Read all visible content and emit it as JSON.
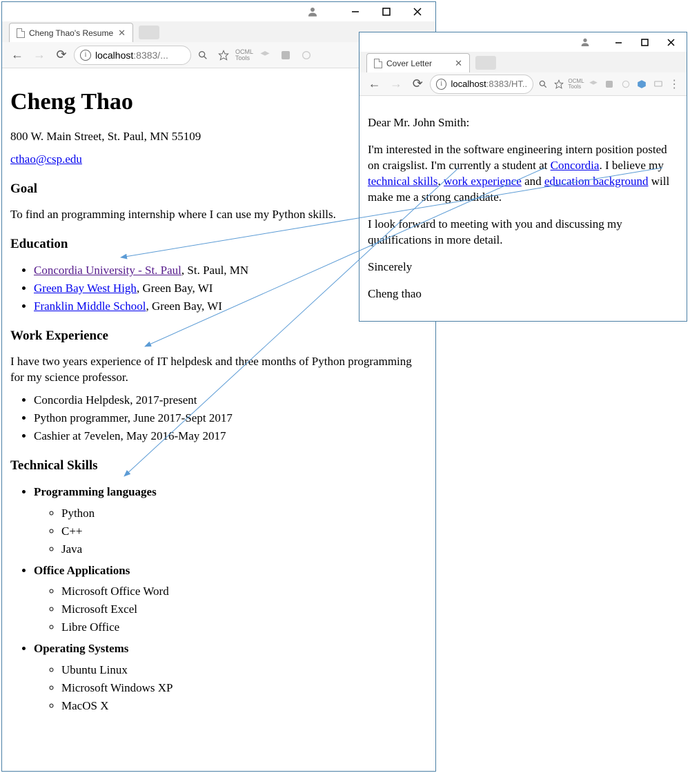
{
  "window1": {
    "tab_title": "Cheng Thao's Resume",
    "url_host": "localhost",
    "url_rest": ":8383/...",
    "content": {
      "name": "Cheng Thao",
      "address": "800 W. Main Street, St. Paul, MN 55109",
      "email": "cthao@csp.edu",
      "goal_h": "Goal",
      "goal": "To find an programming internship where I can use my Python skills.",
      "edu_h": "Education",
      "edu": [
        {
          "link": "Concordia University - St. Paul",
          "rest": ", St. Paul, MN"
        },
        {
          "link": "Green Bay West High",
          "rest": ", Green Bay, WI"
        },
        {
          "link": "Franklin Middle School",
          "rest": ", Green Bay, WI"
        }
      ],
      "work_h": "Work Experience",
      "work_p": "I have two years experience of IT helpdesk and three months of Python programming for my science professor.",
      "work": [
        "Concordia Helpdesk, 2017-present",
        "Python programmer, June 2017-Sept 2017",
        "Cashier at 7evelen, May 2016-May 2017"
      ],
      "skills_h": "Technical Skills",
      "skills": [
        {
          "h": "Programming languages",
          "items": [
            "Python",
            "C++",
            "Java"
          ]
        },
        {
          "h": "Office Applications",
          "items": [
            "Microsoft Office Word",
            "Microsoft Excel",
            "Libre Office"
          ]
        },
        {
          "h": "Operating Systems",
          "items": [
            "Ubuntu Linux",
            "Microsoft Windows XP",
            "MacOS X"
          ]
        }
      ]
    }
  },
  "window2": {
    "tab_title": "Cover Letter",
    "url_host": "localhost",
    "url_rest": ":8383/HT...",
    "content": {
      "greeting": "Dear Mr. John Smith:",
      "p1_a": "I'm interested in the software engineering intern position posted on craigslist. I'm currently a student at ",
      "link_concordia": "Concordia",
      "p1_b": ". I believe my ",
      "link_tech": "technical skills",
      "p1_c": ", ",
      "link_work": "work experience",
      "p1_d": " and ",
      "link_edu": "education background",
      "p1_e": " will make me a strong candidate.",
      "p2": "I look forward to meeting with you and discussing my qualifications in more detail.",
      "closing": "Sincerely",
      "sig": "Cheng thao"
    }
  }
}
